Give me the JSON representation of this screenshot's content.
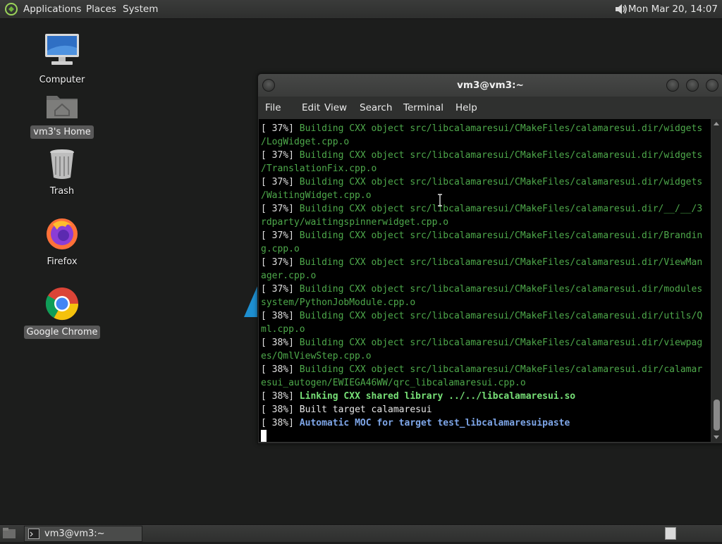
{
  "top_panel": {
    "menus": [
      "Applications",
      "Places",
      "System"
    ],
    "clock": "Mon Mar 20, 14:07"
  },
  "desktop": {
    "icons": [
      {
        "label": "Computer"
      },
      {
        "label": "vm3's Home"
      },
      {
        "label": "Trash"
      },
      {
        "label": "Firefox"
      },
      {
        "label": "Google Chrome"
      }
    ]
  },
  "terminal": {
    "title": "vm3@vm3:~",
    "menu": [
      "File",
      "Edit",
      "View",
      "Search",
      "Terminal",
      "Help"
    ],
    "lines": [
      {
        "pct": "[ 37%] ",
        "text": "Building CXX object src/libcalamaresui/CMakeFiles/calamaresui.dir/widgets",
        "style": "g"
      },
      {
        "pct": "",
        "text": "/LogWidget.cpp.o",
        "style": "g"
      },
      {
        "pct": "[ 37%] ",
        "text": "Building CXX object src/libcalamaresui/CMakeFiles/calamaresui.dir/widgets",
        "style": "g"
      },
      {
        "pct": "",
        "text": "/TranslationFix.cpp.o",
        "style": "g"
      },
      {
        "pct": "[ 37%] ",
        "text": "Building CXX object src/libcalamaresui/CMakeFiles/calamaresui.dir/widgets",
        "style": "g"
      },
      {
        "pct": "",
        "text": "/WaitingWidget.cpp.o",
        "style": "g"
      },
      {
        "pct": "[ 37%] ",
        "text": "Building CXX object src/libcalamaresui/CMakeFiles/calamaresui.dir/__/__/3",
        "style": "g"
      },
      {
        "pct": "",
        "text": "rdparty/waitingspinnerwidget.cpp.o",
        "style": "g"
      },
      {
        "pct": "[ 37%] ",
        "text": "Building CXX object src/libcalamaresui/CMakeFiles/calamaresui.dir/Brandin",
        "style": "g"
      },
      {
        "pct": "",
        "text": "g.cpp.o",
        "style": "g"
      },
      {
        "pct": "[ 37%] ",
        "text": "Building CXX object src/libcalamaresui/CMakeFiles/calamaresui.dir/ViewMan",
        "style": "g"
      },
      {
        "pct": "",
        "text": "ager.cpp.o",
        "style": "g"
      },
      {
        "pct": "[ 37%] ",
        "text": "Building CXX object src/libcalamaresui/CMakeFiles/calamaresui.dir/modules",
        "style": "g"
      },
      {
        "pct": "",
        "text": "system/PythonJobModule.cpp.o",
        "style": "g"
      },
      {
        "pct": "[ 38%] ",
        "text": "Building CXX object src/libcalamaresui/CMakeFiles/calamaresui.dir/utils/Q",
        "style": "g"
      },
      {
        "pct": "",
        "text": "ml.cpp.o",
        "style": "g"
      },
      {
        "pct": "[ 38%] ",
        "text": "Building CXX object src/libcalamaresui/CMakeFiles/calamaresui.dir/viewpag",
        "style": "g"
      },
      {
        "pct": "",
        "text": "es/QmlViewStep.cpp.o",
        "style": "g"
      },
      {
        "pct": "[ 38%] ",
        "text": "Building CXX object src/libcalamaresui/CMakeFiles/calamaresui.dir/calamar",
        "style": "g"
      },
      {
        "pct": "",
        "text": "esui_autogen/EWIEGA46WW/qrc_libcalamaresui.cpp.o",
        "style": "g"
      },
      {
        "pct": "[ 38%] ",
        "text": "Linking CXX shared library ../../libcalamaresui.so",
        "style": "gb"
      },
      {
        "pct": "[ 38%] ",
        "text": "Built target calamaresui",
        "style": "w"
      },
      {
        "pct": "[ 38%] ",
        "text": "Automatic MOC for target test_libcalamaresuipaste",
        "style": "bb"
      }
    ]
  },
  "taskbar": {
    "window_button": "vm3@vm3:~"
  }
}
